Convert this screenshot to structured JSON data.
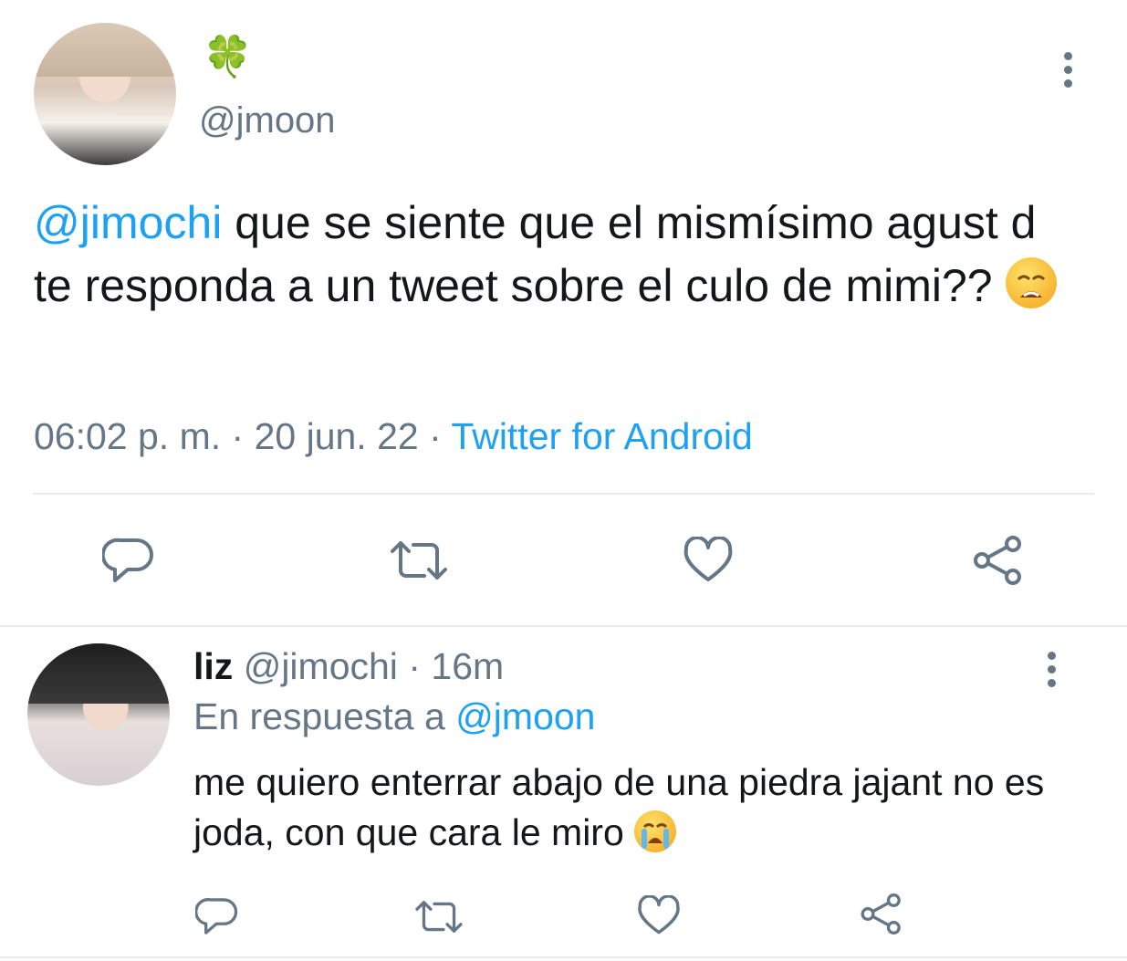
{
  "tweet": {
    "author_emoji": "🍀",
    "handle": "@jmoon",
    "text_mention": "@jimochi",
    "text": " que se siente que el mismísimo agust d te responda a un tweet sobre el culo de mimi?? ",
    "time": "06:02 p. m.",
    "date": "20 jun. 22",
    "separator": "·",
    "source": "Twitter for Android"
  },
  "reply": {
    "name": "liz",
    "handle": "@jimochi",
    "age": "16m",
    "in_reply_to_prefix": "En respuesta a ",
    "in_reply_to_handle": "@jmoon",
    "text": "me quiero enterrar abajo de una piedra jajant no es joda, con que cara le miro "
  },
  "icons": {
    "reply": "reply-icon",
    "retweet": "retweet-icon",
    "like": "heart-icon",
    "share": "share-icon",
    "more": "more-vertical-icon"
  },
  "colors": {
    "accent": "#1da1f2",
    "muted": "#657786",
    "text": "#14171a"
  }
}
